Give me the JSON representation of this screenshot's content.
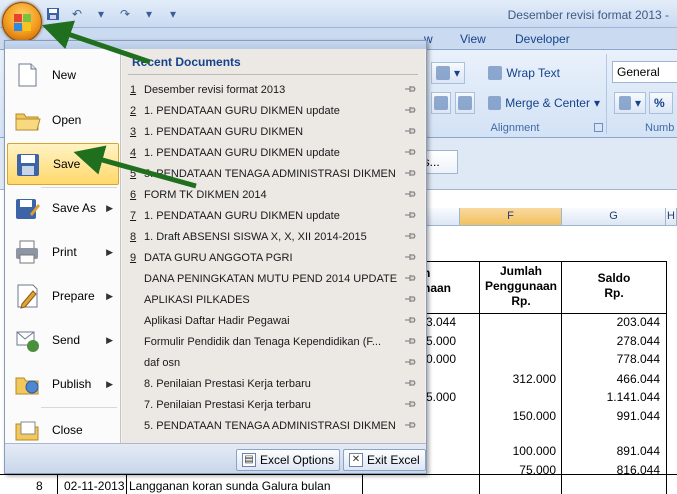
{
  "window": {
    "title": "Desember revisi format 2013 -"
  },
  "ribbon": {
    "tabs": [
      "w",
      "View",
      "Developer"
    ],
    "wrap_text": "Wrap Text",
    "merge_center": "Merge & Center",
    "alignment_label": "Alignment",
    "number_format": "General",
    "number_label": "Numb",
    "percent": "%",
    "fx_button": "ns..."
  },
  "sheet": {
    "columns": [
      "F",
      "G",
      "H"
    ],
    "header_partial": "h\nnaan",
    "header_f": "Jumlah\nPenggunaan\nRp.",
    "header_g": "Saldo\nRp.",
    "col_e_values": [
      "03.044",
      "75.000",
      "00.000",
      "",
      "75.000"
    ],
    "col_f_values": [
      "",
      "",
      "",
      "312.000",
      "",
      "150.000",
      "",
      "100.000",
      "75.000"
    ],
    "col_g_values": [
      "203.044",
      "278.044",
      "778.044",
      "466.044",
      "1.141.044",
      "991.044",
      "",
      "891.044",
      "816.044"
    ],
    "last_row": {
      "num": "8",
      "date": "02-11-2013",
      "desc": "Langganan koran sunda Galura bulan"
    }
  },
  "menu": {
    "items": [
      {
        "label": "New",
        "icon": "new-document-icon",
        "arrow": false
      },
      {
        "label": "Open",
        "icon": "open-folder-icon",
        "arrow": false
      },
      {
        "label": "Save",
        "icon": "save-disk-icon",
        "arrow": false
      },
      {
        "label": "Save As",
        "icon": "save-as-icon",
        "arrow": true
      },
      {
        "label": "Print",
        "icon": "printer-icon",
        "arrow": true
      },
      {
        "label": "Prepare",
        "icon": "prepare-icon",
        "arrow": true
      },
      {
        "label": "Send",
        "icon": "send-icon",
        "arrow": true
      },
      {
        "label": "Publish",
        "icon": "publish-icon",
        "arrow": true
      },
      {
        "label": "Close",
        "icon": "close-folder-icon",
        "arrow": false
      }
    ],
    "recent_title": "Recent Documents",
    "recent": [
      {
        "num": "1",
        "name": "Desember revisi format 2013"
      },
      {
        "num": "2",
        "name": "1. PENDATAAN GURU DIKMEN update"
      },
      {
        "num": "3",
        "name": "1. PENDATAAN GURU DIKMEN"
      },
      {
        "num": "4",
        "name": "1. PENDATAAN GURU DIKMEN update"
      },
      {
        "num": "5",
        "name": "5. PENDATAAN TENAGA ADMINISTRASI DIKMEN"
      },
      {
        "num": "6",
        "name": "FORM TK DIKMEN 2014"
      },
      {
        "num": "7",
        "name": "1. PENDATAAN GURU DIKMEN update"
      },
      {
        "num": "8",
        "name": "1. Draft  ABSENSI SISWA X, X, XII  2014-2015"
      },
      {
        "num": "9",
        "name": "DATA GURU ANGGOTA PGRI"
      },
      {
        "num": "",
        "name": "DANA PENINGKATAN MUTU PEND 2014 UPDATE"
      },
      {
        "num": "",
        "name": "APLIKASI PILKADES"
      },
      {
        "num": "",
        "name": "Aplikasi Daftar Hadir Pegawai"
      },
      {
        "num": "",
        "name": "Formulir Pendidik dan Tenaga Kependidikan (F..."
      },
      {
        "num": "",
        "name": "daf osn"
      },
      {
        "num": "",
        "name": "8. Penilaian Prestasi Kerja terbaru"
      },
      {
        "num": "",
        "name": "7. Penilaian Prestasi Kerja terbaru"
      },
      {
        "num": "",
        "name": "5. PENDATAAN TENAGA ADMINISTRASI DIKMEN"
      }
    ],
    "excel_options": "Excel Options",
    "exit_excel": "Exit Excel"
  },
  "colors": {
    "arrow": "#1f6f1f",
    "accent": "#15428b"
  }
}
